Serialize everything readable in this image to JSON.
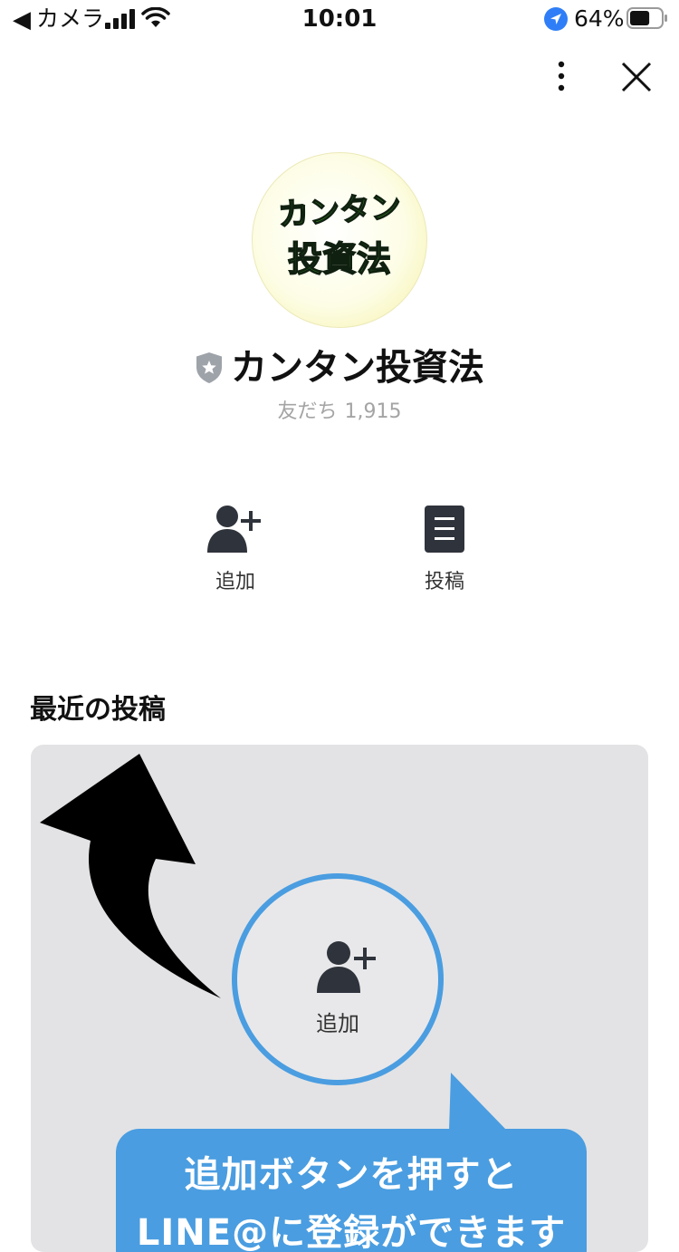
{
  "status_bar": {
    "back_label": "カメラ",
    "time": "10:01",
    "battery_percent": "64%",
    "battery_level": 0.64,
    "icons": [
      "back-arrow-icon",
      "signal-icon",
      "wifi-icon",
      "location-icon",
      "battery-icon"
    ]
  },
  "header": {
    "icons": [
      "more-vertical-icon",
      "close-icon"
    ]
  },
  "profile": {
    "avatar_text_line1": "カンタン",
    "avatar_text_line2": "投資法",
    "name": "カンタン投資法",
    "badge_icon": "shield-star-icon",
    "friends_label": "友だち",
    "friends_count": "1,915"
  },
  "actions": [
    {
      "label": "追加",
      "icon": "add-friend-icon"
    },
    {
      "label": "投稿",
      "icon": "posts-icon"
    }
  ],
  "recent": {
    "title": "最近の投稿",
    "post": {
      "circle_label": "追加",
      "callout_line1": "追加ボタンを押すと",
      "callout_line2": "LINE@に登録ができます"
    }
  },
  "colors": {
    "accent_blue": "#4a9de0",
    "logo_green": "#3c9a24",
    "muted_text": "#a4a4a4",
    "card_bg": "#e3e3e5"
  }
}
